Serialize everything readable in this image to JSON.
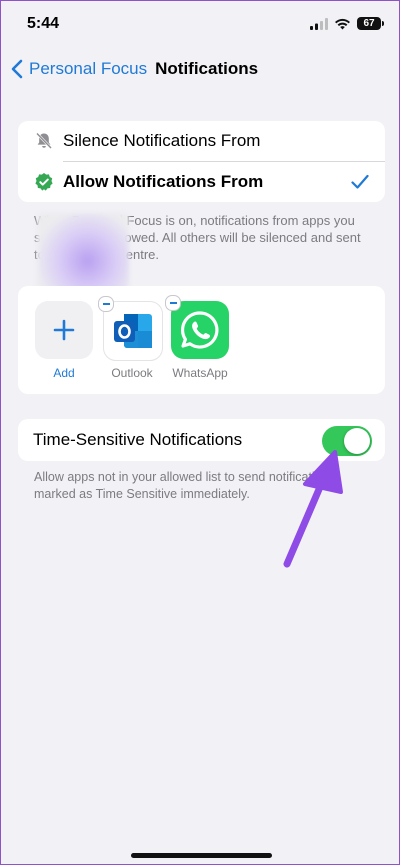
{
  "status": {
    "time": "5:44",
    "battery": "67"
  },
  "nav": {
    "back_label": "Personal Focus",
    "title": "Notifications"
  },
  "mode": {
    "silence_label": "Silence Notifications From",
    "allow_label": "Allow Notifications From"
  },
  "description_lines": [
    "When Personal Focus is on, notifications from apps you",
    "select will be allowed. All others will be silenced and sent",
    "to Notification Centre."
  ],
  "apps": {
    "add_label": "Add",
    "items": [
      {
        "label": "Outlook"
      },
      {
        "label": "WhatsApp"
      }
    ]
  },
  "time_sensitive": {
    "label": "Time-Sensitive Notifications",
    "enabled": true,
    "description_lines": [
      "Allow apps not in your allowed list to send notifications",
      "marked as Time Sensitive immediately."
    ]
  },
  "colors": {
    "accent": "#1f7ad6",
    "toggle_on": "#34c759",
    "annotation_arrow": "#8f4be6"
  }
}
